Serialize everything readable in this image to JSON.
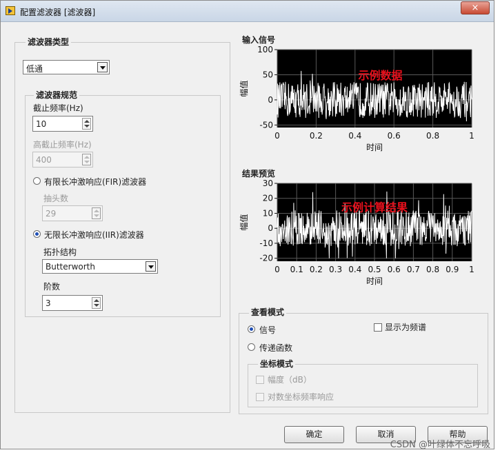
{
  "window": {
    "title": "配置滤波器 [滤波器]",
    "close_symbol": "×"
  },
  "filter_type": {
    "label": "滤波器类型",
    "value": "低通"
  },
  "filter_spec": {
    "label": "滤波器规范",
    "cutoff_label": "截止频率(Hz)",
    "cutoff_value": "10",
    "high_cutoff_label": "高截止频率(Hz)",
    "high_cutoff_value": "400",
    "fir_label": "有限长冲激响应(FIR)滤波器",
    "taps_label": "抽头数",
    "taps_value": "29",
    "iir_label": "无限长冲激响应(IIR)滤波器",
    "topology_label": "拓扑结构",
    "topology_value": "Butterworth",
    "order_label": "阶数",
    "order_value": "3"
  },
  "input_chart": {
    "title": "输入信号",
    "ylabel": "幅值",
    "xlabel": "时间",
    "overlay": "示例数据",
    "yticks": [
      "100",
      "50",
      "0",
      "-50"
    ],
    "xticks": [
      "0",
      "0.2",
      "0.4",
      "0.6",
      "0.8",
      "1"
    ]
  },
  "result_chart": {
    "title": "结果预览",
    "ylabel": "幅值",
    "xlabel": "时间",
    "overlay": "示例计算结果",
    "yticks": [
      "30",
      "20",
      "10",
      "0",
      "-10",
      "-20"
    ],
    "xticks": [
      "0",
      "0.1",
      "0.2",
      "0.3",
      "0.4",
      "0.5",
      "0.6",
      "0.7",
      "0.8",
      "0.9",
      "1"
    ]
  },
  "chart_data": [
    {
      "type": "line",
      "title": "输入信号",
      "xlabel": "时间",
      "ylabel": "幅值",
      "xlim": [
        0,
        1
      ],
      "ylim": [
        -55,
        100
      ],
      "series": [
        {
          "noise_center": 0,
          "noise_amplitude": 40
        }
      ]
    },
    {
      "type": "line",
      "title": "结果预览",
      "xlabel": "时间",
      "ylabel": "幅值",
      "xlim": [
        0,
        1
      ],
      "ylim": [
        -22,
        30
      ],
      "series": [
        {
          "noise_center": 0,
          "noise_amplitude": 15
        }
      ]
    }
  ],
  "view_mode": {
    "label": "查看模式",
    "signal_label": "信号",
    "transfer_label": "传递函数",
    "spectrum_label": "显示为频谱",
    "scale_label": "坐标模式",
    "db_label": "幅度（dB）",
    "logfreq_label": "对数坐标频率响应"
  },
  "buttons": {
    "ok": "确定",
    "cancel": "取消",
    "help": "帮助"
  },
  "watermark": "CSDN @叶绿体不忘呼吸",
  "colors": {
    "plot_bg": "#000000",
    "trace": "#ffffff",
    "overlay": "#e8101c",
    "window_bg": "#f0f0f0"
  }
}
